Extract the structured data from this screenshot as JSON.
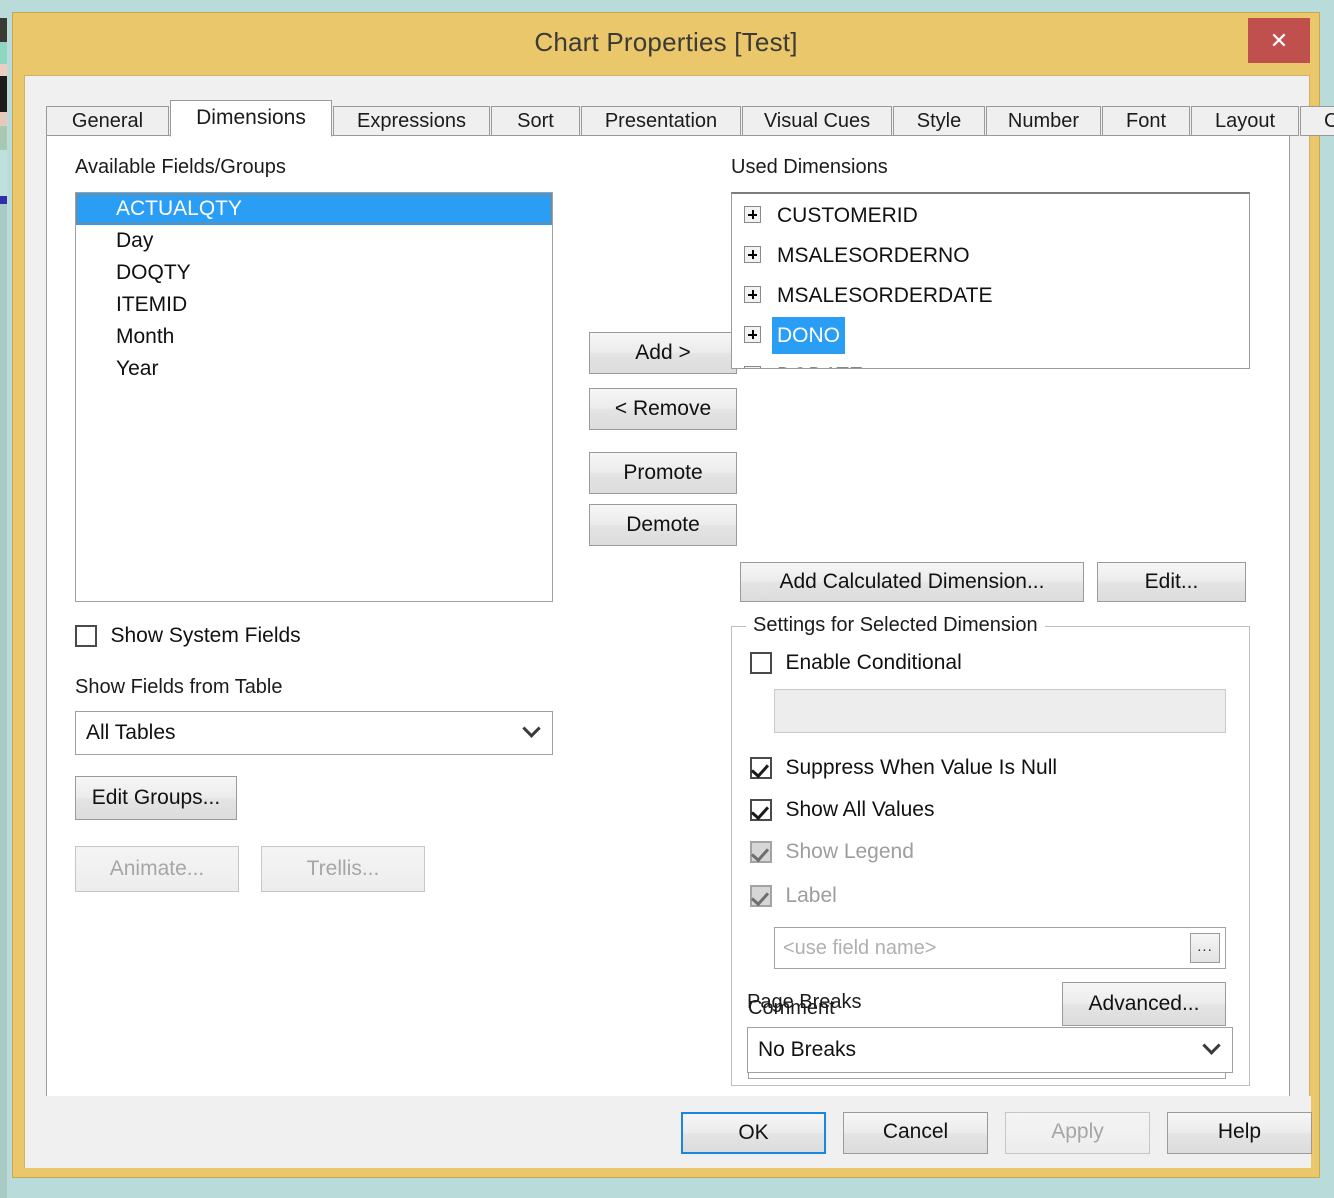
{
  "window": {
    "title": "Chart Properties [Test]",
    "close_label": "✕",
    "frame_color": "#e9c76a",
    "close_color": "#c0504d",
    "desktop_color": "#b9dcdb"
  },
  "tabs": [
    {
      "label": "General",
      "active": false
    },
    {
      "label": "Dimensions",
      "active": true
    },
    {
      "label": "Expressions",
      "active": false
    },
    {
      "label": "Sort",
      "active": false
    },
    {
      "label": "Presentation",
      "active": false
    },
    {
      "label": "Visual Cues",
      "active": false
    },
    {
      "label": "Style",
      "active": false
    },
    {
      "label": "Number",
      "active": false
    },
    {
      "label": "Font",
      "active": false
    },
    {
      "label": "Layout",
      "active": false
    },
    {
      "label": "Caption",
      "active": false
    }
  ],
  "left_panel": {
    "available_label": "Available Fields/Groups",
    "available_fields": [
      {
        "label": "ACTUALQTY",
        "selected": true
      },
      {
        "label": "Day",
        "selected": false
      },
      {
        "label": "DOQTY",
        "selected": false
      },
      {
        "label": "ITEMID",
        "selected": false
      },
      {
        "label": "Month",
        "selected": false
      },
      {
        "label": "Year",
        "selected": false
      }
    ],
    "show_system_fields": {
      "label": "Show System Fields",
      "checked": false
    },
    "show_fields_from_table_label": "Show Fields from Table",
    "table_combo": {
      "value": "All Tables"
    },
    "edit_groups_label": "Edit Groups...",
    "animate_label": "Animate...",
    "trellis_label": "Trellis..."
  },
  "center_buttons": {
    "add": "Add >",
    "remove": "< Remove",
    "promote": "Promote",
    "demote": "Demote"
  },
  "right_panel": {
    "used_dimensions_label": "Used Dimensions",
    "used_dimensions": [
      {
        "label": "CUSTOMERID",
        "selected": false
      },
      {
        "label": "MSALESORDERNO",
        "selected": false
      },
      {
        "label": "MSALESORDERDATE",
        "selected": false
      },
      {
        "label": "DONO",
        "selected": true
      },
      {
        "label": "DODATE",
        "selected": false
      }
    ],
    "add_calculated_label": "Add Calculated Dimension...",
    "edit_label": "Edit...",
    "settings": {
      "group_title": "Settings for Selected Dimension",
      "enable_conditional": {
        "label": "Enable Conditional",
        "checked": false
      },
      "conditional_expression": "",
      "suppress_when_null": {
        "label": "Suppress When Value Is Null",
        "checked": true
      },
      "show_all_values": {
        "label": "Show All Values",
        "checked": true
      },
      "show_legend": {
        "label": "Show Legend",
        "checked": true,
        "disabled": true
      },
      "label_option": {
        "label": "Label",
        "checked": true,
        "disabled": true
      },
      "label_field_placeholder": "<use field name>",
      "label_field_value": "",
      "browse_label": "...",
      "advanced_label": "Advanced...",
      "comment_label": "Comment",
      "comment_value": "",
      "page_breaks_label": "Page Breaks",
      "page_breaks_combo": {
        "value": "No Breaks"
      }
    }
  },
  "footer": {
    "ok": "OK",
    "cancel": "Cancel",
    "apply": "Apply",
    "help": "Help"
  }
}
